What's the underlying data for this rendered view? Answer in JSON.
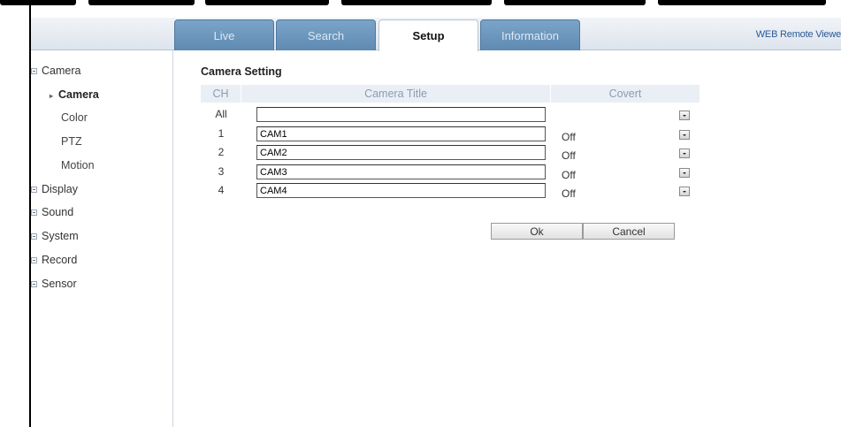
{
  "tabs": [
    {
      "label": "Live",
      "active": false
    },
    {
      "label": "Search",
      "active": false
    },
    {
      "label": "Setup",
      "active": true
    },
    {
      "label": "Information",
      "active": false
    }
  ],
  "header": {
    "right_label": "WEB Remote Viewe"
  },
  "sidebar": {
    "camera": {
      "label": "Camera",
      "children": [
        "Camera",
        "Color",
        "PTZ",
        "Motion"
      ],
      "active_child": "Camera"
    },
    "groups": [
      "Display",
      "Sound",
      "System",
      "Record",
      "Sensor"
    ]
  },
  "camera_setting": {
    "title": "Camera Setting",
    "columns": {
      "ch": "CH",
      "camera_title": "Camera Title",
      "covert": "Covert"
    },
    "rows": [
      {
        "ch": "All",
        "title": "",
        "covert": ""
      },
      {
        "ch": "1",
        "title": "CAM1",
        "covert": "Off"
      },
      {
        "ch": "2",
        "title": "CAM2",
        "covert": "Off"
      },
      {
        "ch": "3",
        "title": "CAM3",
        "covert": "Off"
      },
      {
        "ch": "4",
        "title": "CAM4",
        "covert": "Off"
      }
    ],
    "ok_label": "Ok",
    "cancel_label": "Cancel"
  },
  "colors": {
    "tab_bg": "#6a93bb",
    "header_bg": "#e4eaf1",
    "grid_head_bg": "#e9eff5",
    "link_blue": "#2a5a96"
  }
}
